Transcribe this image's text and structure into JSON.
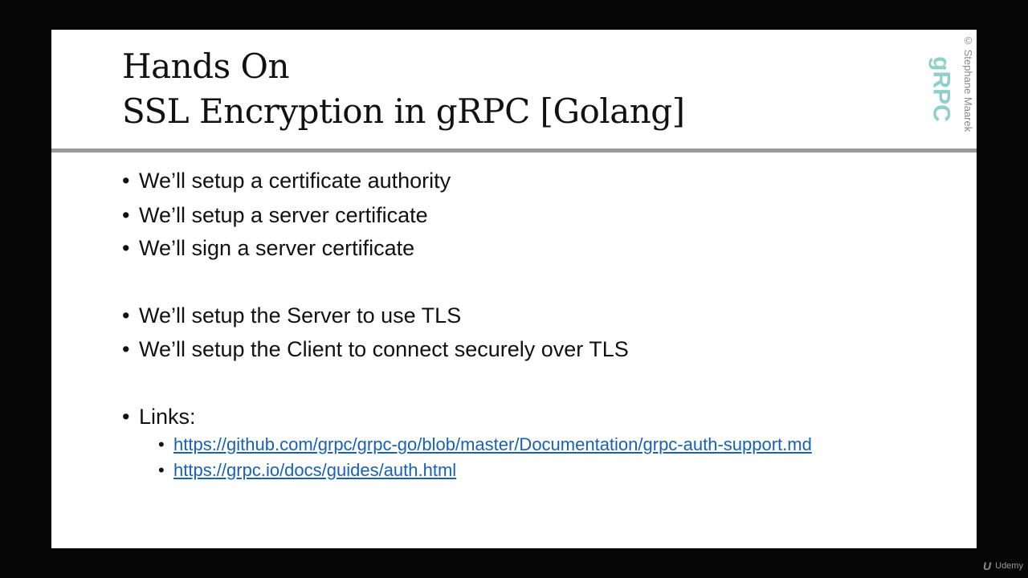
{
  "slide": {
    "title_line1": "Hands On",
    "title_line2": "SSL Encryption in gRPC [Golang]",
    "copyright": "© Stephane Maarek",
    "logo_text": "gRPC",
    "logo_color": "#8fd0cb",
    "bullets": [
      "We’ll setup a certificate authority",
      "We’ll setup a server certificate",
      "We’ll sign a server certificate",
      "We’ll setup the Server to use TLS",
      "We’ll setup the Client to connect securely over TLS",
      "Links:"
    ],
    "links": [
      "https://github.com/grpc/grpc-go/blob/master/Documentation/grpc-auth-support.md",
      "https://grpc.io/docs/guides/auth.html"
    ],
    "bullet_glyph": "•"
  },
  "watermark": {
    "mark": "U",
    "label": "Udemy"
  }
}
